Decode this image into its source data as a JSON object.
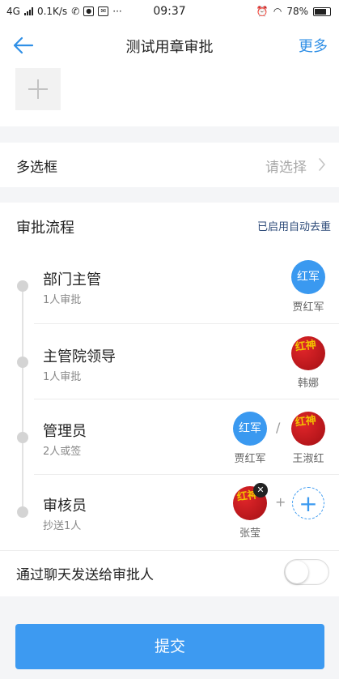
{
  "status_bar": {
    "network": "4G",
    "speed": "0.1K/s",
    "time": "09:37",
    "battery": "78%"
  },
  "header": {
    "title": "测试用章审批",
    "more_label": "更多"
  },
  "multi_select": {
    "label": "多选框",
    "placeholder": "请选择"
  },
  "approval_flow": {
    "title": "审批流程",
    "note": "已启用自动去重",
    "steps": [
      {
        "name": "部门主管",
        "sub": "1人审批",
        "people": [
          {
            "name": "贾红军",
            "avatar_text": "红军",
            "avatar_style": "blue"
          }
        ]
      },
      {
        "name": "主管院领导",
        "sub": "1人审批",
        "people": [
          {
            "name": "韩娜",
            "avatar_style": "red"
          }
        ]
      },
      {
        "name": "管理员",
        "sub": "2人或签",
        "people": [
          {
            "name": "贾红军",
            "avatar_text": "红军",
            "avatar_style": "blue"
          },
          {
            "name": "王淑红",
            "avatar_style": "red"
          }
        ],
        "separator": "/"
      },
      {
        "name": "审核员",
        "sub": "抄送1人",
        "people": [
          {
            "name": "张莹",
            "avatar_style": "red",
            "removable": true
          }
        ],
        "separator": "+"
      }
    ]
  },
  "chat_toggle": {
    "label": "通过聊天发送给审批人",
    "enabled": false
  },
  "submit_label": "提交",
  "colors": {
    "accent": "#2f8fe6",
    "button": "#3d9af1",
    "note": "#2c4a78"
  }
}
